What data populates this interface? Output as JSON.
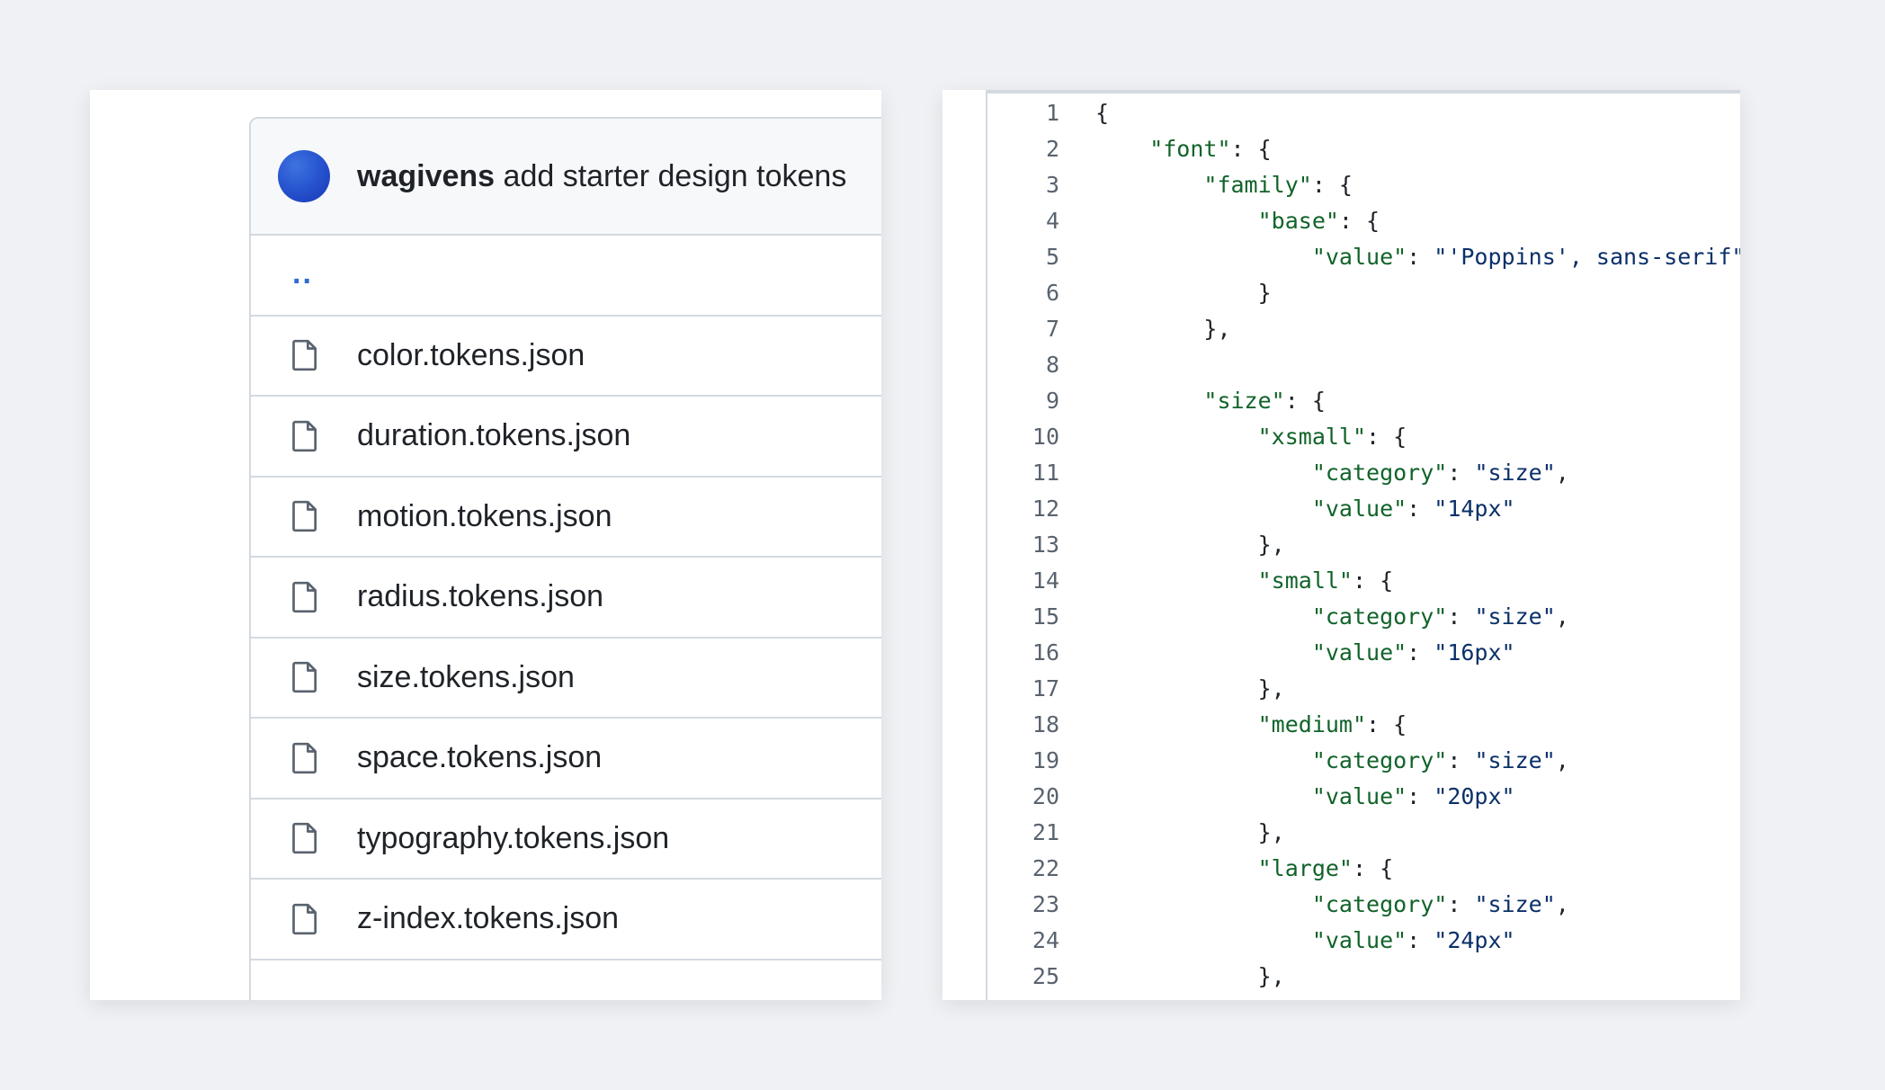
{
  "left": {
    "commit": {
      "author": "wagivens",
      "message": "add starter design tokens"
    },
    "parent_link": "..",
    "files": [
      {
        "name": "color.tokens.json",
        "icon": "file-icon"
      },
      {
        "name": "duration.tokens.json",
        "icon": "file-icon"
      },
      {
        "name": "motion.tokens.json",
        "icon": "file-icon"
      },
      {
        "name": "radius.tokens.json",
        "icon": "file-icon"
      },
      {
        "name": "size.tokens.json",
        "icon": "file-icon"
      },
      {
        "name": "space.tokens.json",
        "icon": "file-icon"
      },
      {
        "name": "typography.tokens.json",
        "icon": "file-icon"
      },
      {
        "name": "z-index.tokens.json",
        "icon": "file-icon"
      }
    ]
  },
  "code": {
    "colors": {
      "key": "#116329",
      "string": "#0a3069",
      "punct": "#1f2328",
      "line_number": "#59636e"
    },
    "lines": [
      {
        "n": "1",
        "indent": 0,
        "tokens": [
          {
            "t": "p",
            "v": "{"
          }
        ]
      },
      {
        "n": "2",
        "indent": 1,
        "tokens": [
          {
            "t": "k",
            "v": "\"font\""
          },
          {
            "t": "p",
            "v": ": {"
          }
        ]
      },
      {
        "n": "3",
        "indent": 2,
        "tokens": [
          {
            "t": "k",
            "v": "\"family\""
          },
          {
            "t": "p",
            "v": ": {"
          }
        ]
      },
      {
        "n": "4",
        "indent": 3,
        "tokens": [
          {
            "t": "k",
            "v": "\"base\""
          },
          {
            "t": "p",
            "v": ": {"
          }
        ]
      },
      {
        "n": "5",
        "indent": 4,
        "tokens": [
          {
            "t": "k",
            "v": "\"value\""
          },
          {
            "t": "p",
            "v": ": "
          },
          {
            "t": "s",
            "v": "\"'Poppins', sans-serif\""
          }
        ]
      },
      {
        "n": "6",
        "indent": 3,
        "tokens": [
          {
            "t": "p",
            "v": "}"
          }
        ]
      },
      {
        "n": "7",
        "indent": 2,
        "tokens": [
          {
            "t": "p",
            "v": "},"
          }
        ]
      },
      {
        "n": "8",
        "indent": 0,
        "tokens": []
      },
      {
        "n": "9",
        "indent": 2,
        "tokens": [
          {
            "t": "k",
            "v": "\"size\""
          },
          {
            "t": "p",
            "v": ": {"
          }
        ]
      },
      {
        "n": "10",
        "indent": 3,
        "tokens": [
          {
            "t": "k",
            "v": "\"xsmall\""
          },
          {
            "t": "p",
            "v": ": {"
          }
        ]
      },
      {
        "n": "11",
        "indent": 4,
        "tokens": [
          {
            "t": "k",
            "v": "\"category\""
          },
          {
            "t": "p",
            "v": ": "
          },
          {
            "t": "s",
            "v": "\"size\""
          },
          {
            "t": "p",
            "v": ","
          }
        ]
      },
      {
        "n": "12",
        "indent": 4,
        "tokens": [
          {
            "t": "k",
            "v": "\"value\""
          },
          {
            "t": "p",
            "v": ": "
          },
          {
            "t": "s",
            "v": "\"14px\""
          }
        ]
      },
      {
        "n": "13",
        "indent": 3,
        "tokens": [
          {
            "t": "p",
            "v": "},"
          }
        ]
      },
      {
        "n": "14",
        "indent": 3,
        "tokens": [
          {
            "t": "k",
            "v": "\"small\""
          },
          {
            "t": "p",
            "v": ": {"
          }
        ]
      },
      {
        "n": "15",
        "indent": 4,
        "tokens": [
          {
            "t": "k",
            "v": "\"category\""
          },
          {
            "t": "p",
            "v": ": "
          },
          {
            "t": "s",
            "v": "\"size\""
          },
          {
            "t": "p",
            "v": ","
          }
        ]
      },
      {
        "n": "16",
        "indent": 4,
        "tokens": [
          {
            "t": "k",
            "v": "\"value\""
          },
          {
            "t": "p",
            "v": ": "
          },
          {
            "t": "s",
            "v": "\"16px\""
          }
        ]
      },
      {
        "n": "17",
        "indent": 3,
        "tokens": [
          {
            "t": "p",
            "v": "},"
          }
        ]
      },
      {
        "n": "18",
        "indent": 3,
        "tokens": [
          {
            "t": "k",
            "v": "\"medium\""
          },
          {
            "t": "p",
            "v": ": {"
          }
        ]
      },
      {
        "n": "19",
        "indent": 4,
        "tokens": [
          {
            "t": "k",
            "v": "\"category\""
          },
          {
            "t": "p",
            "v": ": "
          },
          {
            "t": "s",
            "v": "\"size\""
          },
          {
            "t": "p",
            "v": ","
          }
        ]
      },
      {
        "n": "20",
        "indent": 4,
        "tokens": [
          {
            "t": "k",
            "v": "\"value\""
          },
          {
            "t": "p",
            "v": ": "
          },
          {
            "t": "s",
            "v": "\"20px\""
          }
        ]
      },
      {
        "n": "21",
        "indent": 3,
        "tokens": [
          {
            "t": "p",
            "v": "},"
          }
        ]
      },
      {
        "n": "22",
        "indent": 3,
        "tokens": [
          {
            "t": "k",
            "v": "\"large\""
          },
          {
            "t": "p",
            "v": ": {"
          }
        ]
      },
      {
        "n": "23",
        "indent": 4,
        "tokens": [
          {
            "t": "k",
            "v": "\"category\""
          },
          {
            "t": "p",
            "v": ": "
          },
          {
            "t": "s",
            "v": "\"size\""
          },
          {
            "t": "p",
            "v": ","
          }
        ]
      },
      {
        "n": "24",
        "indent": 4,
        "tokens": [
          {
            "t": "k",
            "v": "\"value\""
          },
          {
            "t": "p",
            "v": ": "
          },
          {
            "t": "s",
            "v": "\"24px\""
          }
        ]
      },
      {
        "n": "25",
        "indent": 3,
        "tokens": [
          {
            "t": "p",
            "v": "},"
          }
        ]
      }
    ]
  }
}
